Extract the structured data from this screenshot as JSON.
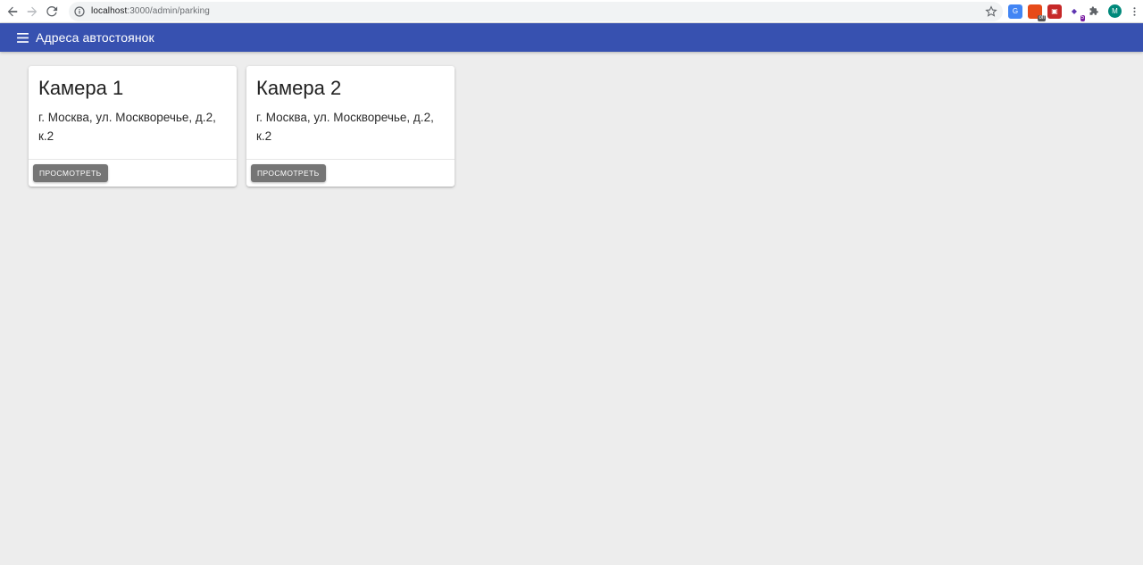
{
  "browser": {
    "url_host": "localhost",
    "url_path": ":3000/admin/parking",
    "extensions": [
      {
        "icon": "translate-icon"
      },
      {
        "icon": "calendar-icon",
        "badge": "off"
      },
      {
        "icon": "screenshot-icon"
      },
      {
        "icon": "gem-icon",
        "badge": "5"
      },
      {
        "icon": "puzzle-icon"
      }
    ],
    "avatar_letter": "M"
  },
  "app_bar": {
    "title": "Адреса автостоянок",
    "color": "#3751b0"
  },
  "cards": [
    {
      "title": "Камера 1",
      "address": "г. Москва, ул. Москворечье, д.2, к.2",
      "button": "ПРОСМОТРЕТЬ"
    },
    {
      "title": "Камера 2",
      "address": "г. Москва, ул. Москворечье, д.2, к.2",
      "button": "ПРОСМОТРЕТЬ"
    }
  ]
}
